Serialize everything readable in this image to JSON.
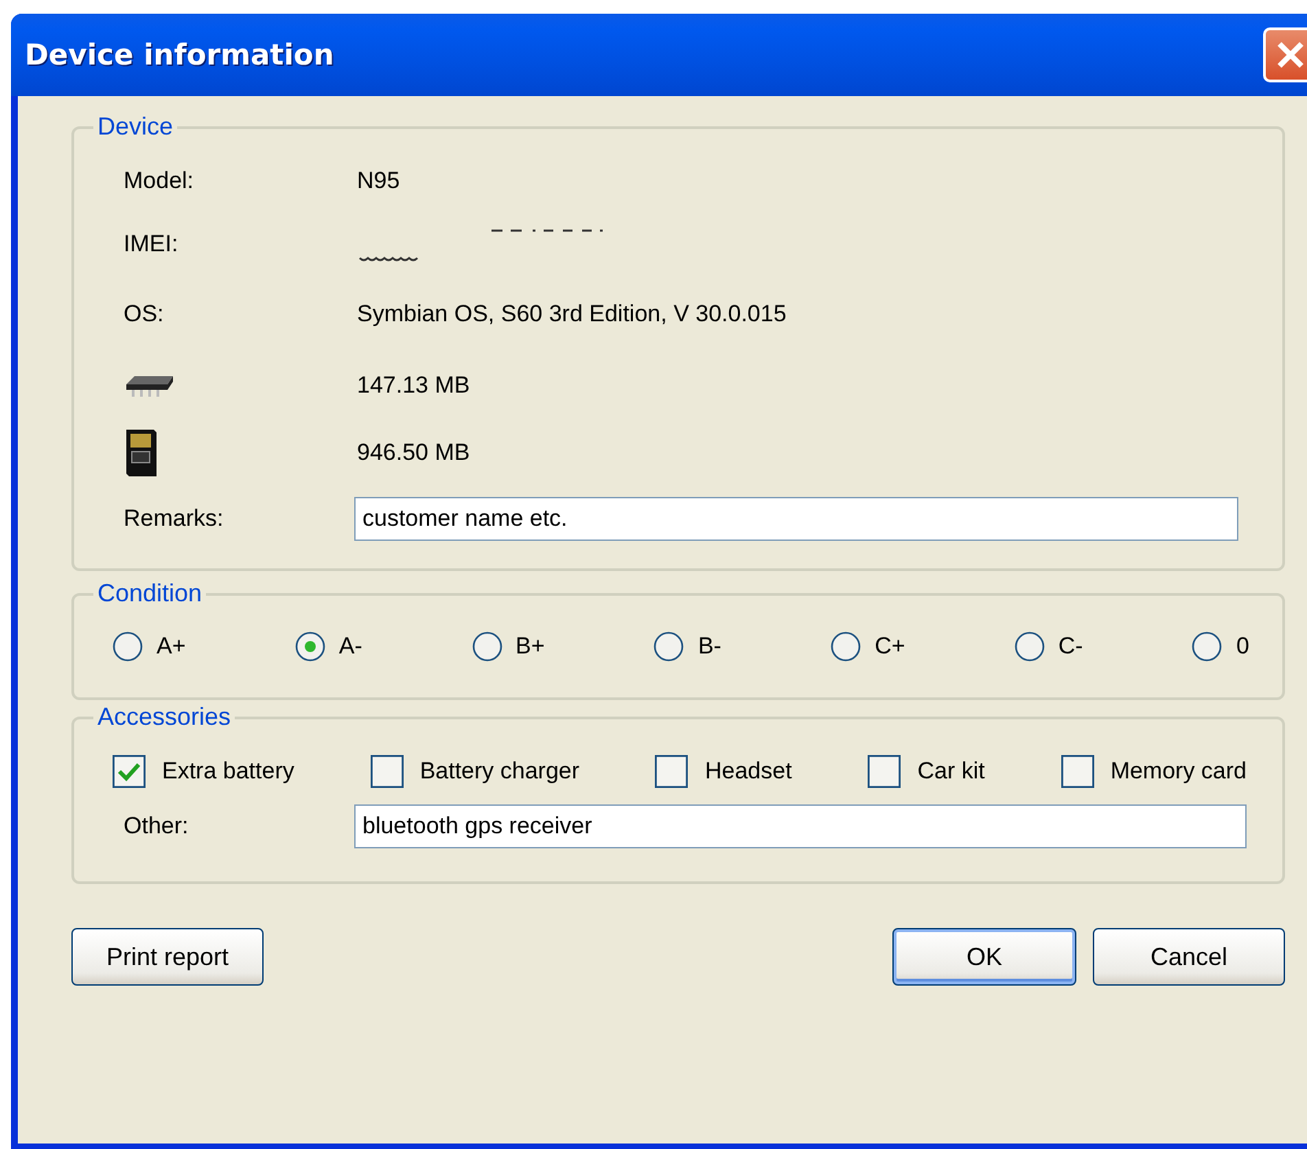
{
  "window": {
    "title": "Device information"
  },
  "device": {
    "legend": "Device",
    "rows": [
      {
        "kind": "text",
        "label": "Model:",
        "value": "N95"
      },
      {
        "kind": "redacted",
        "label": "IMEI:"
      },
      {
        "kind": "text",
        "label": "OS:",
        "value": "Symbian OS, S60 3rd Edition, V 30.0.015"
      },
      {
        "kind": "ram",
        "value": "147.13 MB"
      },
      {
        "kind": "card",
        "value": "946.50 MB"
      }
    ],
    "remarks": {
      "label": "Remarks:",
      "value": "customer name etc."
    }
  },
  "condition": {
    "legend": "Condition",
    "options": [
      {
        "label": "A+",
        "selected": false
      },
      {
        "label": "A-",
        "selected": true
      },
      {
        "label": "B+",
        "selected": false
      },
      {
        "label": "B-",
        "selected": false
      },
      {
        "label": "C+",
        "selected": false
      },
      {
        "label": "C-",
        "selected": false
      },
      {
        "label": "0",
        "selected": false
      }
    ]
  },
  "accessories": {
    "legend": "Accessories",
    "items": [
      {
        "label": "Extra battery",
        "checked": true
      },
      {
        "label": "Battery charger",
        "checked": false
      },
      {
        "label": "Headset",
        "checked": false
      },
      {
        "label": "Car kit",
        "checked": false
      },
      {
        "label": "Memory card",
        "checked": false
      }
    ],
    "other": {
      "label": "Other:",
      "value": "bluetooth gps receiver"
    }
  },
  "buttons": [
    {
      "label": "Print report",
      "default": false
    },
    {
      "label": "OK",
      "default": true
    },
    {
      "label": "Cancel",
      "default": false
    }
  ]
}
